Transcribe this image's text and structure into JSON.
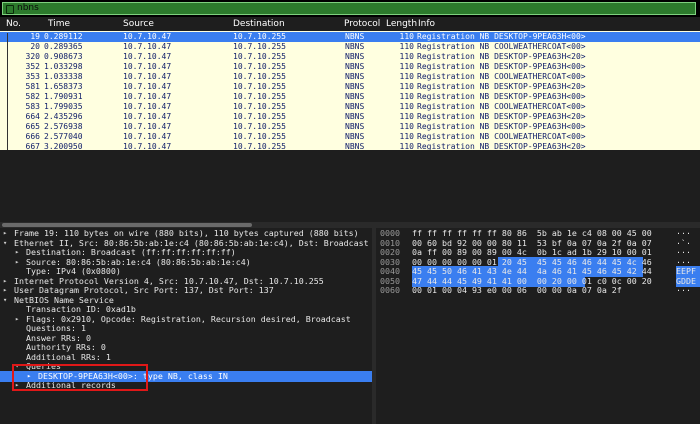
{
  "filter": {
    "value": "nbns",
    "icon": "bookmark-icon",
    "color": "#2c7a2c"
  },
  "packet_list": {
    "columns": [
      "No.",
      "Time",
      "Source",
      "Destination",
      "Protocol",
      "Length",
      "Info"
    ],
    "rows": [
      {
        "no": "19",
        "time": "0.289112",
        "src": "10.7.10.47",
        "dst": "10.7.10.255",
        "proto": "NBNS",
        "len": "110",
        "info": "Registration NB DESKTOP-9PEA63H<00>",
        "selected": true
      },
      {
        "no": "20",
        "time": "0.289365",
        "src": "10.7.10.47",
        "dst": "10.7.10.255",
        "proto": "NBNS",
        "len": "110",
        "info": "Registration NB COOLWEATHERCOAT<00>"
      },
      {
        "no": "320",
        "time": "0.908673",
        "src": "10.7.10.47",
        "dst": "10.7.10.255",
        "proto": "NBNS",
        "len": "110",
        "info": "Registration NB DESKTOP-9PEA63H<20>"
      },
      {
        "no": "352",
        "time": "1.033298",
        "src": "10.7.10.47",
        "dst": "10.7.10.255",
        "proto": "NBNS",
        "len": "110",
        "info": "Registration NB DESKTOP-9PEA63H<00>"
      },
      {
        "no": "353",
        "time": "1.033338",
        "src": "10.7.10.47",
        "dst": "10.7.10.255",
        "proto": "NBNS",
        "len": "110",
        "info": "Registration NB COOLWEATHERCOAT<00>"
      },
      {
        "no": "581",
        "time": "1.658373",
        "src": "10.7.10.47",
        "dst": "10.7.10.255",
        "proto": "NBNS",
        "len": "110",
        "info": "Registration NB DESKTOP-9PEA63H<20>"
      },
      {
        "no": "582",
        "time": "1.790931",
        "src": "10.7.10.47",
        "dst": "10.7.10.255",
        "proto": "NBNS",
        "len": "110",
        "info": "Registration NB DESKTOP-9PEA63H<00>"
      },
      {
        "no": "583",
        "time": "1.799035",
        "src": "10.7.10.47",
        "dst": "10.7.10.255",
        "proto": "NBNS",
        "len": "110",
        "info": "Registration NB COOLWEATHERCOAT<00>"
      },
      {
        "no": "664",
        "time": "2.435296",
        "src": "10.7.10.47",
        "dst": "10.7.10.255",
        "proto": "NBNS",
        "len": "110",
        "info": "Registration NB DESKTOP-9PEA63H<20>"
      },
      {
        "no": "665",
        "time": "2.576938",
        "src": "10.7.10.47",
        "dst": "10.7.10.255",
        "proto": "NBNS",
        "len": "110",
        "info": "Registration NB DESKTOP-9PEA63H<00>"
      },
      {
        "no": "666",
        "time": "2.577040",
        "src": "10.7.10.47",
        "dst": "10.7.10.255",
        "proto": "NBNS",
        "len": "110",
        "info": "Registration NB COOLWEATHERCOAT<00>"
      },
      {
        "no": "667",
        "time": "3.200950",
        "src": "10.7.10.47",
        "dst": "10.7.10.255",
        "proto": "NBNS",
        "len": "110",
        "info": "Registration NB DESKTOP-9PEA63H<20>"
      }
    ]
  },
  "details": [
    {
      "arrow": "▸",
      "text": "Frame 19: 110 bytes on wire (880 bits), 110 bytes captured (880 bits)",
      "indent": 0
    },
    {
      "arrow": "▾",
      "text": "Ethernet II, Src: 80:86:5b:ab:1e:c4 (80:86:5b:ab:1e:c4), Dst: Broadcast",
      "indent": 0
    },
    {
      "arrow": "▸",
      "text": "Destination: Broadcast (ff:ff:ff:ff:ff:ff)",
      "indent": 1
    },
    {
      "arrow": "▸",
      "text": "Source: 80:86:5b:ab:1e:c4 (80:86:5b:ab:1e:c4)",
      "indent": 1
    },
    {
      "arrow": "",
      "text": "Type: IPv4 (0x0800)",
      "indent": 1
    },
    {
      "arrow": "▸",
      "text": "Internet Protocol Version 4, Src: 10.7.10.47, Dst: 10.7.10.255",
      "indent": 0
    },
    {
      "arrow": "▸",
      "text": "User Datagram Protocol, Src Port: 137, Dst Port: 137",
      "indent": 0
    },
    {
      "arrow": "▾",
      "text": "NetBIOS Name Service",
      "indent": 0
    },
    {
      "arrow": "",
      "text": "Transaction ID: 0xad1b",
      "indent": 1
    },
    {
      "arrow": "▸",
      "text": "Flags: 0x2910, Opcode: Registration, Recursion desired, Broadcast",
      "indent": 1
    },
    {
      "arrow": "",
      "text": "Questions: 1",
      "indent": 1
    },
    {
      "arrow": "",
      "text": "Answer RRs: 0",
      "indent": 1
    },
    {
      "arrow": "",
      "text": "Authority RRs: 0",
      "indent": 1
    },
    {
      "arrow": "",
      "text": "Additional RRs: 1",
      "indent": 1
    },
    {
      "arrow": "▾",
      "text": "Queries",
      "indent": 1
    },
    {
      "arrow": "▸",
      "text": "DESKTOP-9PEA63H<00>: type NB, class IN",
      "indent": 2,
      "selected": true
    },
    {
      "arrow": "▸",
      "text": "Additional records",
      "indent": 1
    }
  ],
  "hex": [
    {
      "offset": "0000",
      "bytes": "ff ff ff ff ff ff 80 86  5b ab 1e c4 08 00 45 00",
      "ascii": "···"
    },
    {
      "offset": "0010",
      "bytes": "00 60 bd 92 00 00 80 11  53 bf 0a 07 0a 2f 0a 07",
      "ascii": "·`·"
    },
    {
      "offset": "0020",
      "bytes": "0a ff 00 89 00 89 00 4c  0b 1c ad 1b 29 10 00 01",
      "ascii": "···"
    },
    {
      "offset": "0030",
      "bytes": "00 00 00 00 00 01 20 45  45 45 46 46 44 45 4c 46",
      "ascii": "···",
      "hl_from": 6
    },
    {
      "offset": "0040",
      "bytes": "45 45 50 46 41 43 4e 44  4a 46 41 45 46 45 42 44",
      "ascii": "EEPF",
      "hl_from": 0
    },
    {
      "offset": "0050",
      "bytes": "47 44 44 45 49 41 41 00  00 20 00 01 c0 0c 00 20",
      "ascii": "GDDE",
      "hl_from": 0,
      "hl_to": 11
    },
    {
      "offset": "0060",
      "bytes": "00 01 00 04 93 e0 00 06  00 00 0a 07 0a 2f",
      "ascii": "···"
    }
  ],
  "colors": {
    "selection": "#3a7ef0",
    "list_bg": "#ffffe0",
    "list_text": "#12206b",
    "callout": "#e01818"
  }
}
